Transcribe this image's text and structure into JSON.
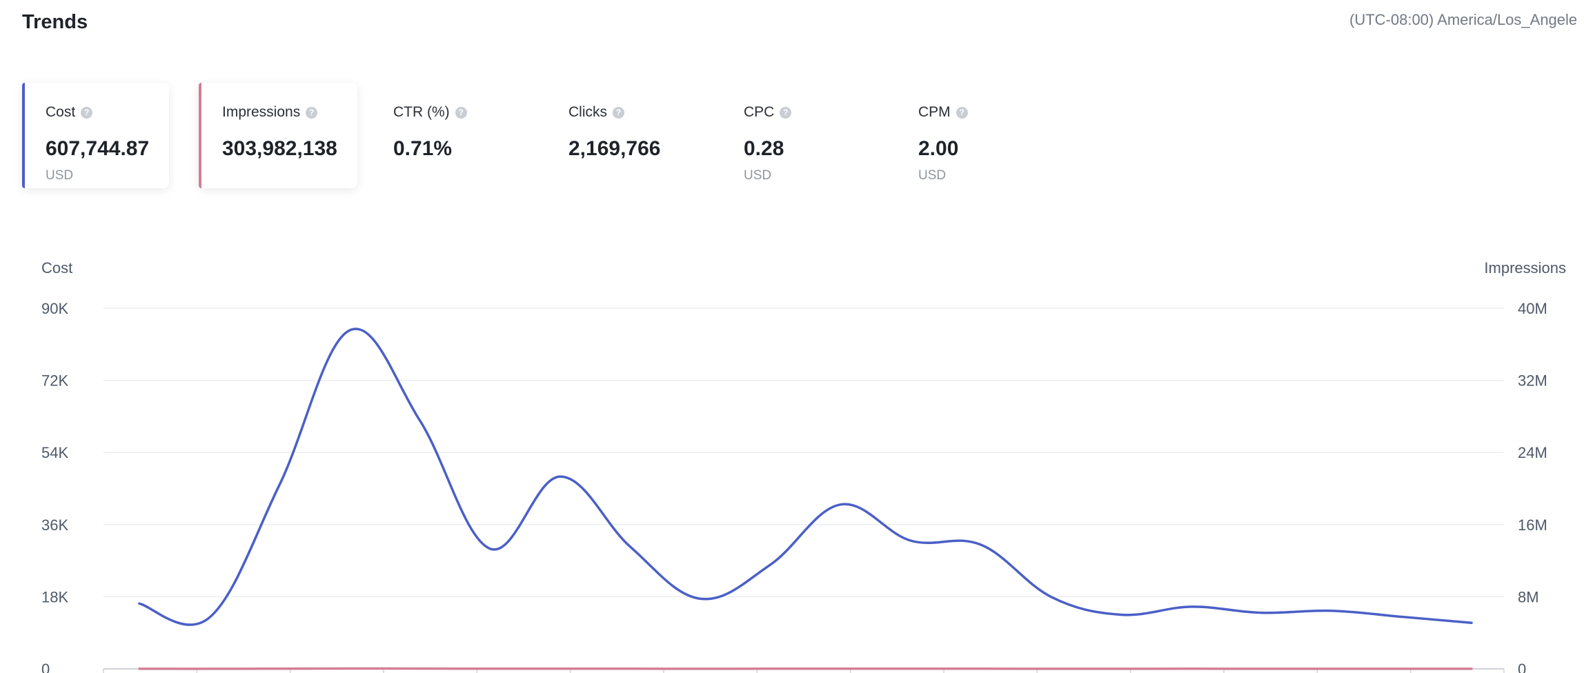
{
  "header": {
    "title": "Trends",
    "timezone": "(UTC-08:00) America/Los_Angele"
  },
  "metrics": [
    {
      "label": "Cost",
      "value": "607,744.87",
      "unit": "USD",
      "selected": true,
      "color": "#4a5fc7"
    },
    {
      "label": "Impressions",
      "value": "303,982,138",
      "unit": "",
      "selected": true,
      "color": "#d47d97"
    },
    {
      "label": "CTR (%)",
      "value": "0.71%",
      "unit": "",
      "selected": false
    },
    {
      "label": "Clicks",
      "value": "2,169,766",
      "unit": "",
      "selected": false
    },
    {
      "label": "CPC",
      "value": "0.28",
      "unit": "USD",
      "selected": false
    },
    {
      "label": "CPM",
      "value": "2.00",
      "unit": "USD",
      "selected": false
    }
  ],
  "chart_data": {
    "type": "line",
    "y_left_label": "Cost",
    "y_right_label": "Impressions",
    "y_left_ticks": [
      "0",
      "18K",
      "36K",
      "54K",
      "72K",
      "90K"
    ],
    "y_right_ticks": [
      "0",
      "8M",
      "16M",
      "24M",
      "32M",
      "40M"
    ],
    "ylim_left": [
      0,
      90000
    ],
    "ylim_right": [
      0,
      40000000
    ],
    "grid": true,
    "x": [
      0,
      1,
      2,
      3,
      4,
      5,
      6,
      7,
      8,
      9,
      10,
      11,
      12,
      13,
      14,
      15,
      16,
      17,
      18,
      19
    ],
    "series": [
      {
        "name": "Cost",
        "axis": "left",
        "color": "#4a5fc7",
        "values": [
          16300,
          12800,
          46000,
          84500,
          62000,
          30000,
          48000,
          30500,
          17500,
          26000,
          41000,
          32000,
          31000,
          18000,
          13500,
          15500,
          14000,
          14500,
          13000,
          11500
        ]
      },
      {
        "name": "Impressions",
        "axis": "right",
        "color": "#d47d97",
        "values": [
          4400,
          4600,
          21000,
          37600,
          28500,
          14800,
          26100,
          16000,
          8800,
          12500,
          19800,
          17000,
          16000,
          9600,
          8100,
          14300,
          9500,
          8500,
          7800,
          7200
        ]
      }
    ]
  }
}
